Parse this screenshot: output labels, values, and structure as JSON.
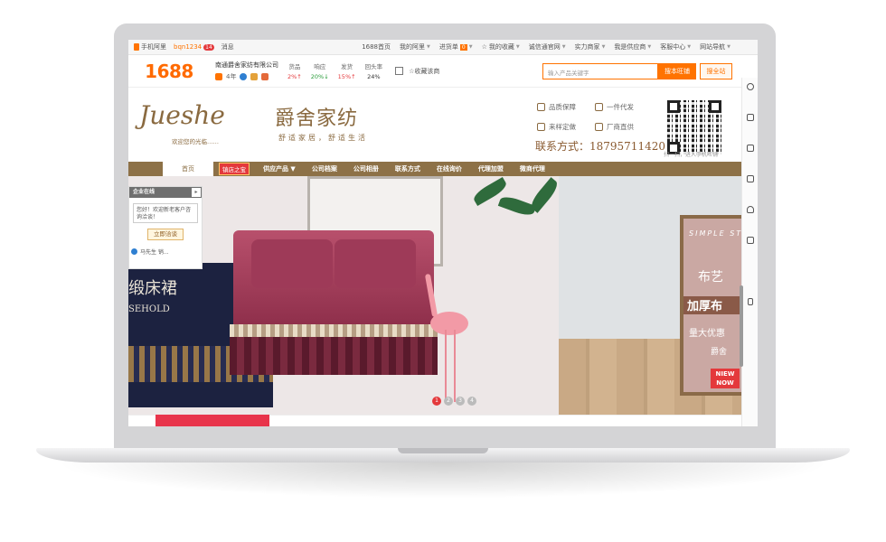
{
  "topbar": {
    "mobile_label": "手机阿里",
    "user": "bqn1234",
    "message_badge": "14",
    "message_label": "消息",
    "links": [
      {
        "label": "1688首页"
      },
      {
        "label": "我的阿里"
      },
      {
        "label": "进货单",
        "badge": "0"
      },
      {
        "label": "我的收藏"
      },
      {
        "label": "诚信通官网"
      },
      {
        "label": "实力商家"
      },
      {
        "label": "我是供应商"
      },
      {
        "label": "客服中心"
      },
      {
        "label": "网站导航"
      }
    ]
  },
  "header": {
    "logo": "1688",
    "company": "南通爵舍家纺有限公司",
    "years": "4年",
    "metrics": [
      {
        "label": "货品",
        "value": "2%↑",
        "trend": "up"
      },
      {
        "label": "响应",
        "value": "20%↓",
        "trend": "down"
      },
      {
        "label": "发货",
        "value": "15%↑",
        "trend": "up"
      },
      {
        "label": "回头率",
        "value": "24%",
        "trend": "neutral"
      }
    ],
    "favorite_label": "收藏该商",
    "search_placeholder": "输入产品关键字",
    "search_shop_button": "搜本旺铺",
    "search_all_button": "搜全站"
  },
  "brand": {
    "script_name": "Jueshe",
    "welcome": "欢迎您的光临……",
    "cn_name": "爵舍家纺",
    "slogan": "舒适家居，舒适生活",
    "services": [
      "品质保障",
      "一件代发",
      "来样定做",
      "厂商直供"
    ],
    "contact": "联系方式：18795711420",
    "qr_caption": "扫一扫，进入手机旺铺"
  },
  "nav": {
    "home": "首页",
    "hot": "镇店之宝",
    "items": [
      "供应产品 ▼",
      "公司档案",
      "公司相册",
      "联系方式",
      "在线询价",
      "代理加盟",
      "微商代理"
    ]
  },
  "chat": {
    "title": "企业在线",
    "arrow": "▸",
    "greeting": "您好！欢迎新老客户咨询洽谈！",
    "button": "立即洽谈",
    "agent": "马先生 销..."
  },
  "hero": {
    "left_text1": "缎床裙",
    "left_text2": "SEHOLD",
    "promo_line1": "SIMPLE STY",
    "promo_line2": "布艺",
    "promo_line3": "加厚布",
    "promo_line4": "量大优惠",
    "promo_line5": "爵舍",
    "promo_new": "NIEW NOW",
    "dots": [
      "1",
      "2",
      "3",
      "4"
    ]
  }
}
